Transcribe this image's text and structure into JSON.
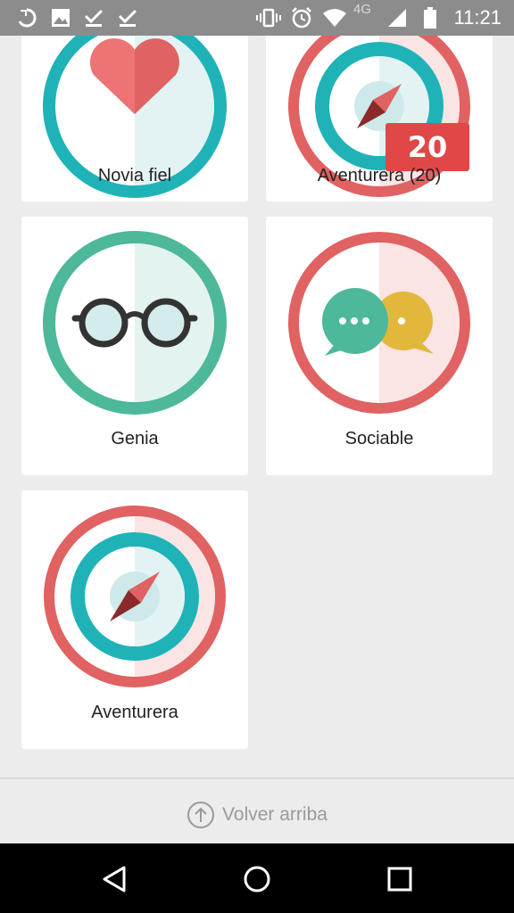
{
  "status_bar": {
    "time": "11:21",
    "network": "4G",
    "icons": [
      "data-saver-icon",
      "image-icon",
      "check-icon",
      "check-icon",
      "vibrate-icon",
      "alarm-icon",
      "wifi-icon",
      "signal-icon",
      "battery-icon"
    ]
  },
  "badges": [
    {
      "label": "Novia fiel",
      "icon": "heart-badge-icon"
    },
    {
      "label": "Aventurera (20)",
      "icon": "compass-badge-icon",
      "count_badge": "20"
    },
    {
      "label": "Genia",
      "icon": "glasses-badge-icon"
    },
    {
      "label": "Sociable",
      "icon": "chat-bubbles-badge-icon"
    },
    {
      "label": "Aventurera",
      "icon": "compass-badge-icon"
    }
  ],
  "footer": {
    "back_to_top": "Volver arriba",
    "icon": "arrow-up-circle-icon"
  },
  "nav_bar": {
    "icons": [
      "back-triangle-icon",
      "home-circle-icon",
      "recents-square-icon"
    ]
  },
  "colors": {
    "red": "#e06262",
    "teal": "#1fb3b8",
    "green": "#4db89a",
    "yellow": "#e2b83c",
    "card_bg": "#ffffff",
    "page_bg": "#ececec"
  }
}
